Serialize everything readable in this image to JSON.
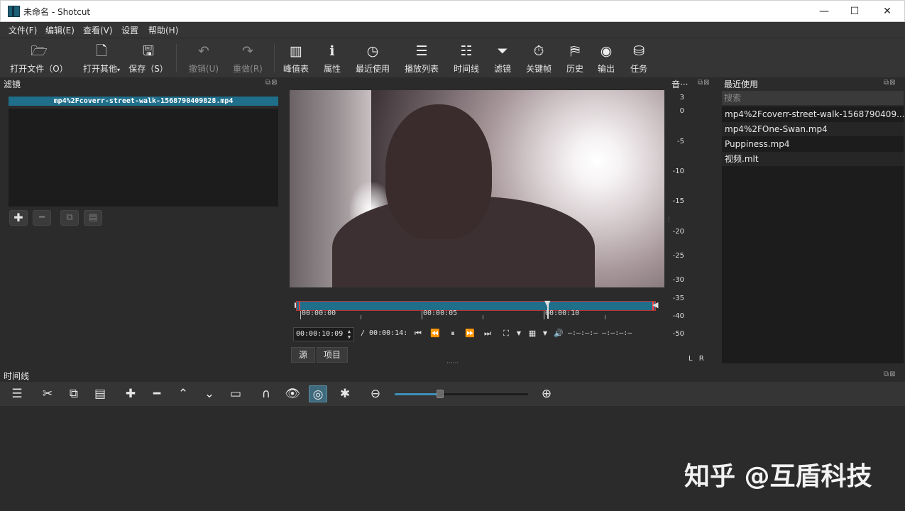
{
  "window": {
    "title": "未命名 - Shotcut",
    "minimize": "—",
    "maximize": "☐",
    "close": "✕"
  },
  "menu": [
    "文件(F)",
    "编辑(E)",
    "查看(V)",
    "设置",
    "帮助(H)"
  ],
  "toolbar": {
    "open_file": "打开文件（O）",
    "open_other": "打开其他",
    "save": "保存（S）",
    "undo": "撤销(U)",
    "redo": "重做(R)",
    "peak_meter": "峰值表",
    "properties": "属性",
    "recent": "最近使用",
    "playlist": "播放列表",
    "timeline": "时间线",
    "filters": "滤镜",
    "keyframes": "关键帧",
    "history": "历史",
    "export": "输出",
    "jobs": "任务"
  },
  "filters_panel": {
    "title": "滤镜",
    "clip_name": "mp4%2Fcoverr-street-walk-1568790409828.mp4"
  },
  "player": {
    "ruler_labels": [
      "00:00:00",
      "00:00:05",
      "00:00:10"
    ],
    "current_time": "00:00:10:09",
    "total_time": "/ 00:00:14:",
    "volume_readout": "—:—:—:—  —:—:—:—",
    "tabs": [
      "源",
      "项目"
    ]
  },
  "audio_panel": {
    "title": "音···",
    "db_scale": [
      "3",
      "0",
      "-5",
      "-10",
      "-15",
      "-20",
      "-25",
      "-30",
      "-35",
      "-40",
      "-50"
    ],
    "channels": "L R"
  },
  "recent_panel": {
    "title": "最近使用",
    "search_placeholder": "搜索",
    "items": [
      "mp4%2Fcoverr-street-walk-1568790409...",
      "mp4%2FOne-Swan.mp4",
      "Puppiness.mp4",
      "视频.mlt"
    ]
  },
  "timeline_panel": {
    "title": "时间线",
    "zoom_level": 0.32
  },
  "watermark": "知乎 @互盾科技",
  "colors": {
    "accent": "#1f6f8b",
    "panel_bg": "#2b2b2b",
    "toolbar_bg": "#353535",
    "list_bg": "#1c1c1c",
    "slider_fill": "#3d8fb8"
  }
}
